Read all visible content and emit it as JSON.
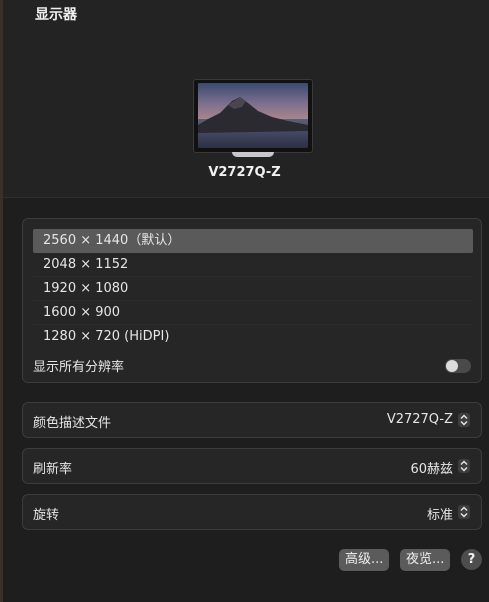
{
  "window": {
    "title": "显示器"
  },
  "display": {
    "name": "V2727Q-Z"
  },
  "resolutions": [
    {
      "label": "2560 × 1440（默认）",
      "selected": true
    },
    {
      "label": "2048 × 1152",
      "selected": false
    },
    {
      "label": "1920 × 1080",
      "selected": false
    },
    {
      "label": "1600 × 900",
      "selected": false
    },
    {
      "label": "1280 × 720 (HiDPI)",
      "selected": false
    }
  ],
  "show_all": {
    "label": "显示所有分辨率",
    "enabled": false
  },
  "color_profile": {
    "label": "颜色描述文件",
    "value": "V2727Q-Z"
  },
  "refresh_rate": {
    "label": "刷新率",
    "value": "60赫兹"
  },
  "rotation": {
    "label": "旋转",
    "value": "标准"
  },
  "buttons": {
    "advanced": "高级...",
    "night_shift": "夜览...",
    "help": "?"
  },
  "colors": {
    "background": "#1e1e1e",
    "selected_row": "#5a5a5a",
    "button": "#5b5b5b"
  }
}
